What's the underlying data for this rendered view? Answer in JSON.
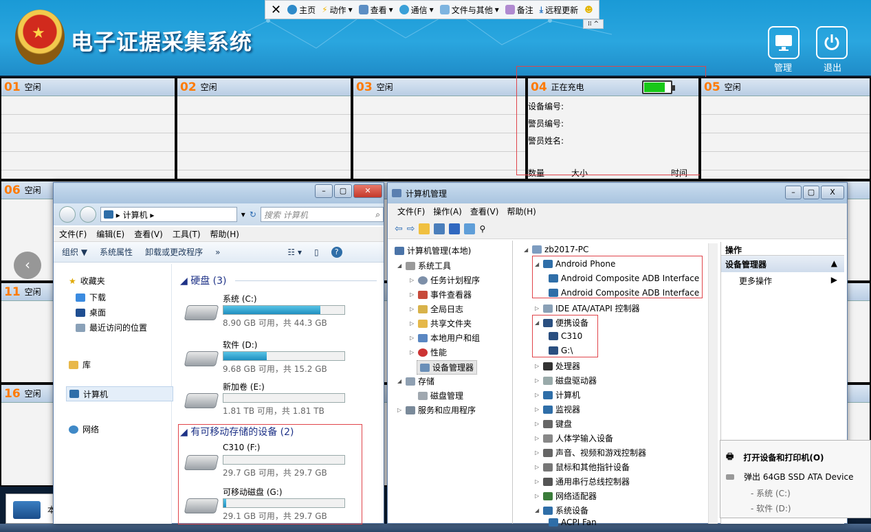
{
  "app": {
    "title": "电子证据采集系统"
  },
  "toolbar": {
    "items": [
      {
        "label": "主页",
        "icon": "home-icon"
      },
      {
        "label": "动作",
        "icon": "lightning-icon"
      },
      {
        "label": "查看",
        "icon": "view-icon"
      },
      {
        "label": "通信",
        "icon": "phone-icon"
      },
      {
        "label": "文件与其他",
        "icon": "file-icon"
      },
      {
        "label": "备注",
        "icon": "note-icon"
      },
      {
        "label": "远程更新",
        "icon": "download-icon"
      }
    ],
    "grip": "⁞⁞ ^"
  },
  "header_buttons": {
    "manage": "管理",
    "exit": "退出"
  },
  "slots": [
    {
      "num": "01",
      "status": "空闲"
    },
    {
      "num": "02",
      "status": "空闲"
    },
    {
      "num": "03",
      "status": "空闲"
    },
    {
      "num": "04",
      "status": "正在充电"
    },
    {
      "num": "05",
      "status": "空闲"
    },
    {
      "num": "06",
      "status": "空闲"
    },
    {
      "num": "11",
      "status": "空闲"
    },
    {
      "num": "16",
      "status": "空闲"
    }
  ],
  "slot04": {
    "device_no": "设备编号:",
    "officer_no": "警员编号:",
    "officer_name": "警员姓名:",
    "col_count": "数量",
    "col_size": "大小",
    "col_time": "时间"
  },
  "explorer": {
    "controls": {
      "min": "–",
      "max": "▢",
      "close": "✕"
    },
    "address": "▸ 计算机 ▸",
    "refresh": "↻",
    "search_placeholder": "搜索 计算机",
    "menu": [
      "文件(F)",
      "编辑(E)",
      "查看(V)",
      "工具(T)",
      "帮助(H)"
    ],
    "commands": [
      "组织 ▼",
      "系统属性",
      "卸载或更改程序",
      "»"
    ],
    "nav": {
      "favorites": "收藏夹",
      "downloads": "下载",
      "desktop": "桌面",
      "recent": "最近访问的位置",
      "libraries": "库",
      "computer": "计算机",
      "network": "网络"
    },
    "hdd_group": "硬盘 (3)",
    "removable_group": "有可移动存储的设备 (2)",
    "drives": [
      {
        "name": "系统 (C:)",
        "info": "8.90 GB 可用，共 44.3 GB",
        "used": 0.8
      },
      {
        "name": "软件 (D:)",
        "info": "9.68 GB 可用，共 15.2 GB",
        "used": 0.36
      },
      {
        "name": "新加卷 (E:)",
        "info": "1.81 TB 可用，共 1.81 TB",
        "used": 0.0
      },
      {
        "name": "C310 (F:)",
        "info": "29.7 GB 可用，共 29.7 GB",
        "used": 0.0
      },
      {
        "name": "可移动磁盘 (G:)",
        "info": "29.1 GB 可用，共 29.7 GB",
        "used": 0.02
      }
    ]
  },
  "compmgmt": {
    "title": "计算机管理",
    "controls": {
      "min": "–",
      "max": "▢",
      "close": "X"
    },
    "menu": [
      "文件(F)",
      "操作(A)",
      "查看(V)",
      "帮助(H)"
    ],
    "tree_left": [
      "计算机管理(本地)",
      "系统工具",
      "任务计划程序",
      "事件查看器",
      "全局日志",
      "共享文件夹",
      "本地用户和组",
      "性能",
      "设备管理器",
      "存储",
      "磁盘管理",
      "服务和应用程序"
    ],
    "device_tree": [
      "zb2017-PC",
      "Android Phone",
      "Android Composite ADB Interface",
      "Android Composite ADB Interface",
      "IDE ATA/ATAPI 控制器",
      "便携设备",
      "C310",
      "G:\\",
      "处理器",
      "磁盘驱动器",
      "计算机",
      "监视器",
      "键盘",
      "人体学输入设备",
      "声音、视频和游戏控制器",
      "鼠标和其他指针设备",
      "通用串行总线控制器",
      "网络适配器",
      "系统设备",
      "ACPI Fan"
    ],
    "actions": {
      "header": "操作",
      "section": "设备管理器",
      "more": "更多操作"
    }
  },
  "context_menu": {
    "open_devices": "打开设备和打印机(O)",
    "eject": "弹出 64GB SSD ATA Device",
    "sub1": "- 系统 (C:)",
    "sub2": "- 软件 (D:)"
  },
  "taskbar_label": "本"
}
